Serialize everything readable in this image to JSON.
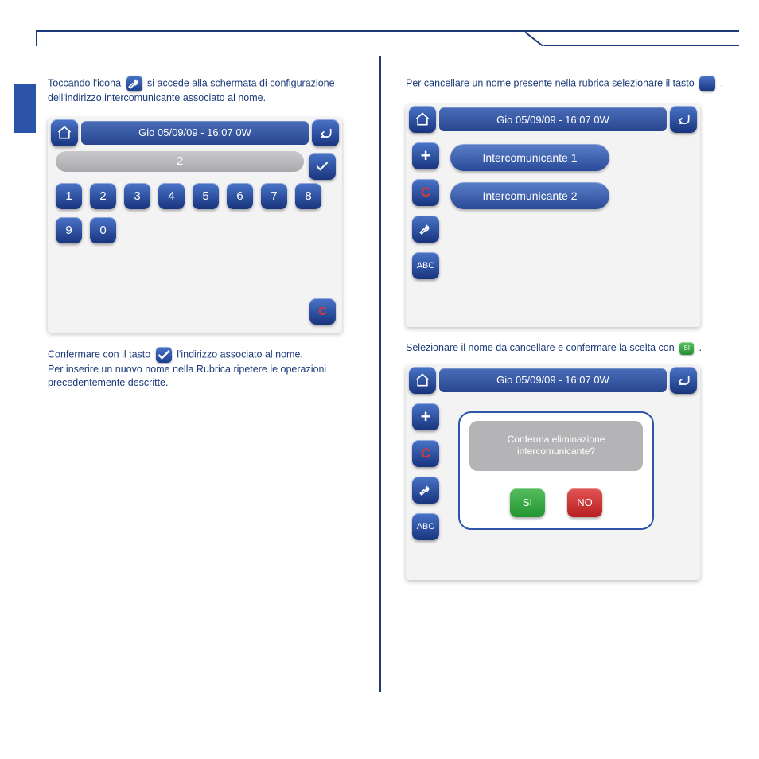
{
  "header_datetime": "Gio 05/09/09 - 16:07   0W",
  "left": {
    "intro_prefix": "Toccando l'icona ",
    "intro_suffix": " si accede alla schermata di configurazione dell'indirizzo intercomunicante associato al nome.",
    "input_value": "2",
    "keys": [
      "1",
      "2",
      "3",
      "4",
      "5",
      "6",
      "7",
      "8",
      "9",
      "0"
    ],
    "clear_key": "C",
    "below_prefix": "Confermare con il tasto ",
    "below_mid": " l'indirizzo associato al nome.\nPer inserire un nuovo nome nella Rubrica ripetere le operazioni precedentemente descritte."
  },
  "right": {
    "intro_prefix": "Per cancellare un nome presente nella rubrica selezionare il tasto ",
    "intro_suffix": ".",
    "items": [
      "Intercomunicante 1",
      "Intercomunicante 2"
    ],
    "side_labels": {
      "plus": "+",
      "clear": "C",
      "abc": "ABC"
    },
    "para2_prefix": "Selezionare il nome da cancellare e confermare la scelta con ",
    "para2_suffix": ".",
    "dialog_msg": "Conferma eliminazione intercomunicante?",
    "yes": "SI",
    "no": "NO"
  }
}
